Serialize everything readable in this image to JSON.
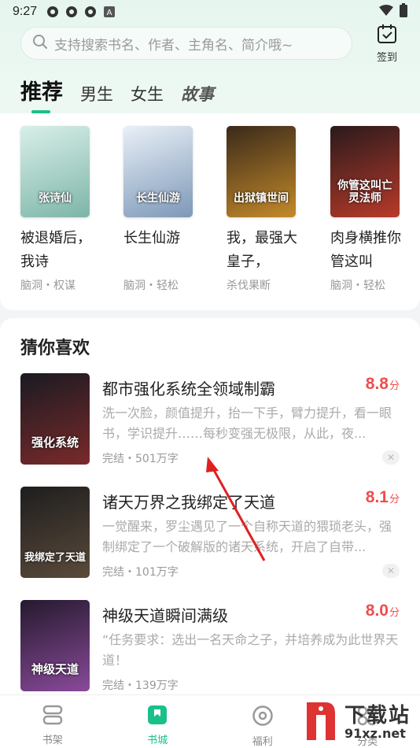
{
  "status_bar": {
    "time": "9:27",
    "notification_icons": [
      "app-icon",
      "app-icon",
      "app-icon",
      "a-icon"
    ],
    "right_icons": [
      "wifi-icon",
      "battery-icon"
    ]
  },
  "search": {
    "placeholder": "支持搜索书名、作者、主角名、简介哦~"
  },
  "signin": {
    "label": "签到"
  },
  "tabs": [
    {
      "label": "推荐",
      "active": true
    },
    {
      "label": "男生",
      "active": false
    },
    {
      "label": "女生",
      "active": false
    },
    {
      "label": "故事",
      "active": false
    }
  ],
  "recommend": [
    {
      "title": "被退婚后，我诗",
      "tags": "脑洞・权谋",
      "cover_text": "张诗仙",
      "color_a": "#d8efe9",
      "color_b": "#7db5a8"
    },
    {
      "title": "长生仙游",
      "tags": "脑洞・轻松",
      "cover_text": "长生仙游",
      "color_a": "#e9f0f7",
      "color_b": "#7d98b8"
    },
    {
      "title": "我，最强大皇子，",
      "tags": "杀伐果断",
      "cover_text": "出狱镇世间",
      "color_a": "#3a2a1a",
      "color_b": "#c48a2a"
    },
    {
      "title": "肉身横推你管这叫",
      "tags": "脑洞・轻松",
      "cover_text": "你管这叫亡灵法师",
      "color_a": "#2a1a1c",
      "color_b": "#b83a2a"
    }
  ],
  "guess": {
    "heading": "猜你喜欢",
    "items": [
      {
        "title": "都市强化系统全领域制霸",
        "score": "8.8",
        "score_unit": "分",
        "desc": "洗一次脸，颜值提升，抬一下手，臂力提升，看一眼书，学识提升……每秒变强无极限，从此，夜...",
        "meta": "完结・501万字",
        "cover_text": "强化系统",
        "color_a": "#1a1a22",
        "color_b": "#7a2a2a"
      },
      {
        "title": "诸天万界之我绑定了天道",
        "score": "8.1",
        "score_unit": "分",
        "desc": "一觉醒来，罗尘遇见了一个自称天道的猥琐老头，强制绑定了一个破解版的诸天系统，开启了自带...",
        "meta": "完结・101万字",
        "cover_text": "我绑定了天道",
        "color_a": "#1e1e1e",
        "color_b": "#5a4a3a"
      },
      {
        "title": "神级天道瞬间满级",
        "score": "8.0",
        "score_unit": "分",
        "desc": "“任务要求：选出一名天命之子，并培养成为此世界天道！",
        "meta": "完结・139万字",
        "cover_text": "神级天道",
        "color_a": "#241a2e",
        "color_b": "#8a4a9a"
      }
    ]
  },
  "bottom_nav": [
    {
      "label": "书架",
      "icon": "bookshelf-icon",
      "active": false
    },
    {
      "label": "书城",
      "icon": "bookstore-icon",
      "active": true
    },
    {
      "label": "福利",
      "icon": "welfare-icon",
      "active": false
    },
    {
      "label": "分类",
      "icon": "category-icon",
      "active": false
    }
  ],
  "watermark": {
    "line1": "下载站",
    "line2": "91xz.net"
  },
  "colors": {
    "accent": "#19c08a",
    "score": "#f04d4d",
    "arrow": "#e02020"
  }
}
